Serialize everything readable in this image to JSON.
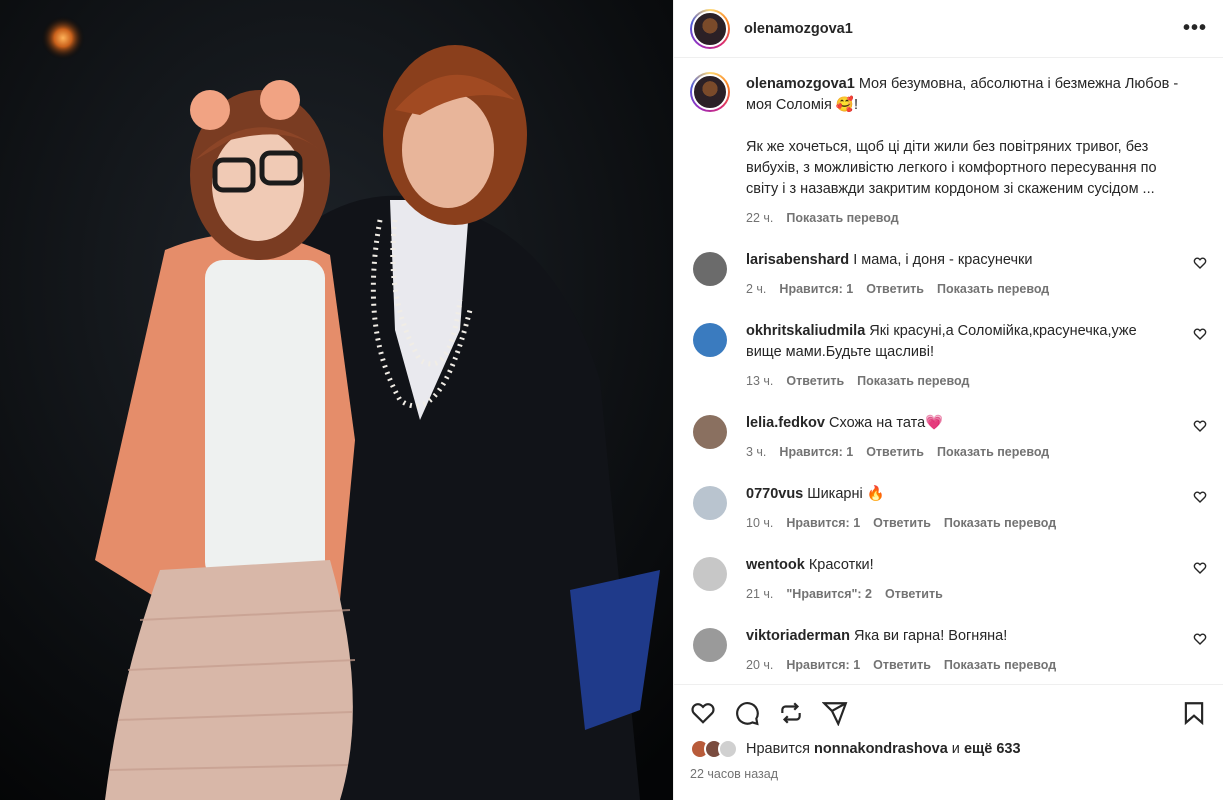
{
  "post": {
    "username": "olenamozgova1",
    "caption_line1": "Моя безумовна, абсолютна і безмежна Любов - моя Соломія 🥰!",
    "caption_line2": "Як же хочеться, щоб ці діти жили без повітряних тривог, без вибухів, з можливістю легкого і комфортного пересування по світу і з назавжди закритим кордоном зі скаженим сусідом ...",
    "time": "22 ч.",
    "translate": "Показать перевод",
    "more_icon": "more-horizontal-icon"
  },
  "comments": [
    {
      "user": "larisabenshard",
      "text": "І мама, і доня - красунечки",
      "time": "2 ч.",
      "likes": "Нравится: 1",
      "reply": "Ответить",
      "translate": "Показать перевод",
      "avatar_color": "#6b6b6b"
    },
    {
      "user": "okhritskaliudmila",
      "text": "Які красуні,а Соломійка,красунечка,уже вище мами.Будьте щасливі!",
      "time": "13 ч.",
      "likes": "",
      "reply": "Ответить",
      "translate": "Показать перевод",
      "avatar_color": "#3a7bbf"
    },
    {
      "user": "lelia.fedkov",
      "text": "Схожа на тата💗",
      "time": "3 ч.",
      "likes": "Нравится: 1",
      "reply": "Ответить",
      "translate": "Показать перевод",
      "avatar_color": "#8a7060"
    },
    {
      "user": "0770vus",
      "text": "Шикарні 🔥",
      "time": "10 ч.",
      "likes": "Нравится: 1",
      "reply": "Ответить",
      "translate": "Показать перевод",
      "avatar_color": "#b9c4cf"
    },
    {
      "user": "wentook",
      "text": "Красотки!",
      "time": "21 ч.",
      "likes": "\"Нравится\": 2",
      "reply": "Ответить",
      "translate": "",
      "avatar_color": "#c7c7c7"
    },
    {
      "user": "viktoriaderman",
      "text": "Яка ви гарна! Вогняна!",
      "time": "20 ч.",
      "likes": "Нравится: 1",
      "reply": "Ответить",
      "translate": "Показать перевод",
      "avatar_color": "#9a9a9a"
    }
  ],
  "footer": {
    "likes_prefix": "Нравится",
    "likes_user": "nonnakondrashova",
    "likes_and": "и",
    "likes_more": "ещё 633",
    "time_full": "22 часов назад"
  },
  "colors": {
    "accent_link": "#737373",
    "heart": "#ff3040"
  },
  "icons": [
    "heart-icon",
    "comment-icon",
    "repost-icon",
    "share-icon",
    "bookmark-icon"
  ]
}
